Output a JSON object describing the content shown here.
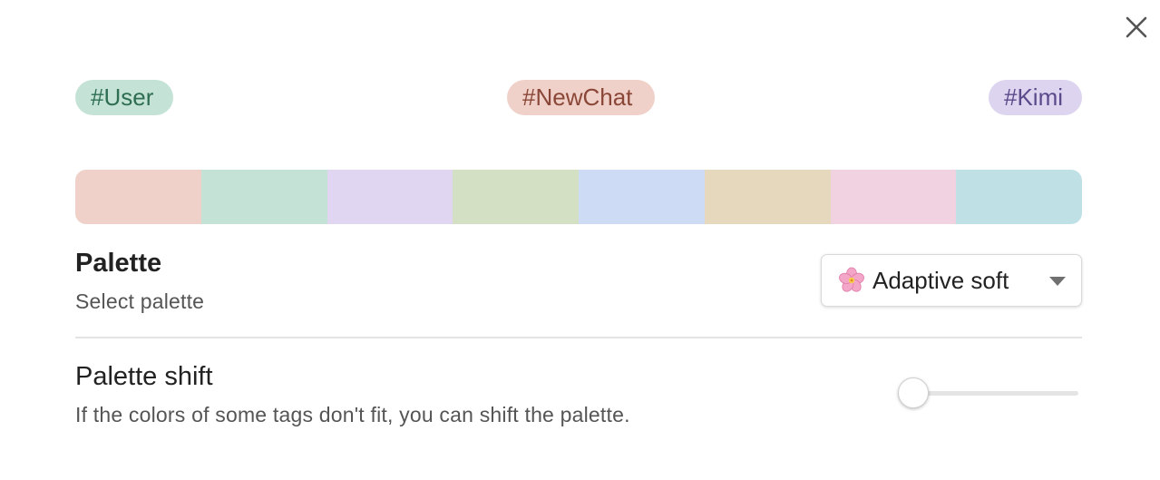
{
  "close": {
    "icon": "close-icon"
  },
  "tags": [
    {
      "label": "#User",
      "bg": "#c4e3d6",
      "color": "#2f6e52"
    },
    {
      "label": "#NewChat",
      "bg": "#f0d1c9",
      "color": "#8a4737"
    },
    {
      "label": "#Kimi",
      "bg": "#ddd4f0",
      "color": "#5a4a8a"
    }
  ],
  "swatches": [
    "#efd1c9",
    "#c4e3d6",
    "#e0d6f1",
    "#d3e0c4",
    "#cddcf4",
    "#e5d8bc",
    "#f0d2e0",
    "#bfe1e6"
  ],
  "palette": {
    "title": "Palette",
    "description": "Select palette",
    "selected": {
      "icon": "cherry-blossom-icon",
      "label": "Adaptive soft"
    }
  },
  "shift": {
    "title": "Palette shift",
    "description": "If the colors of some tags don't fit, you can shift the palette.",
    "value": 0
  }
}
